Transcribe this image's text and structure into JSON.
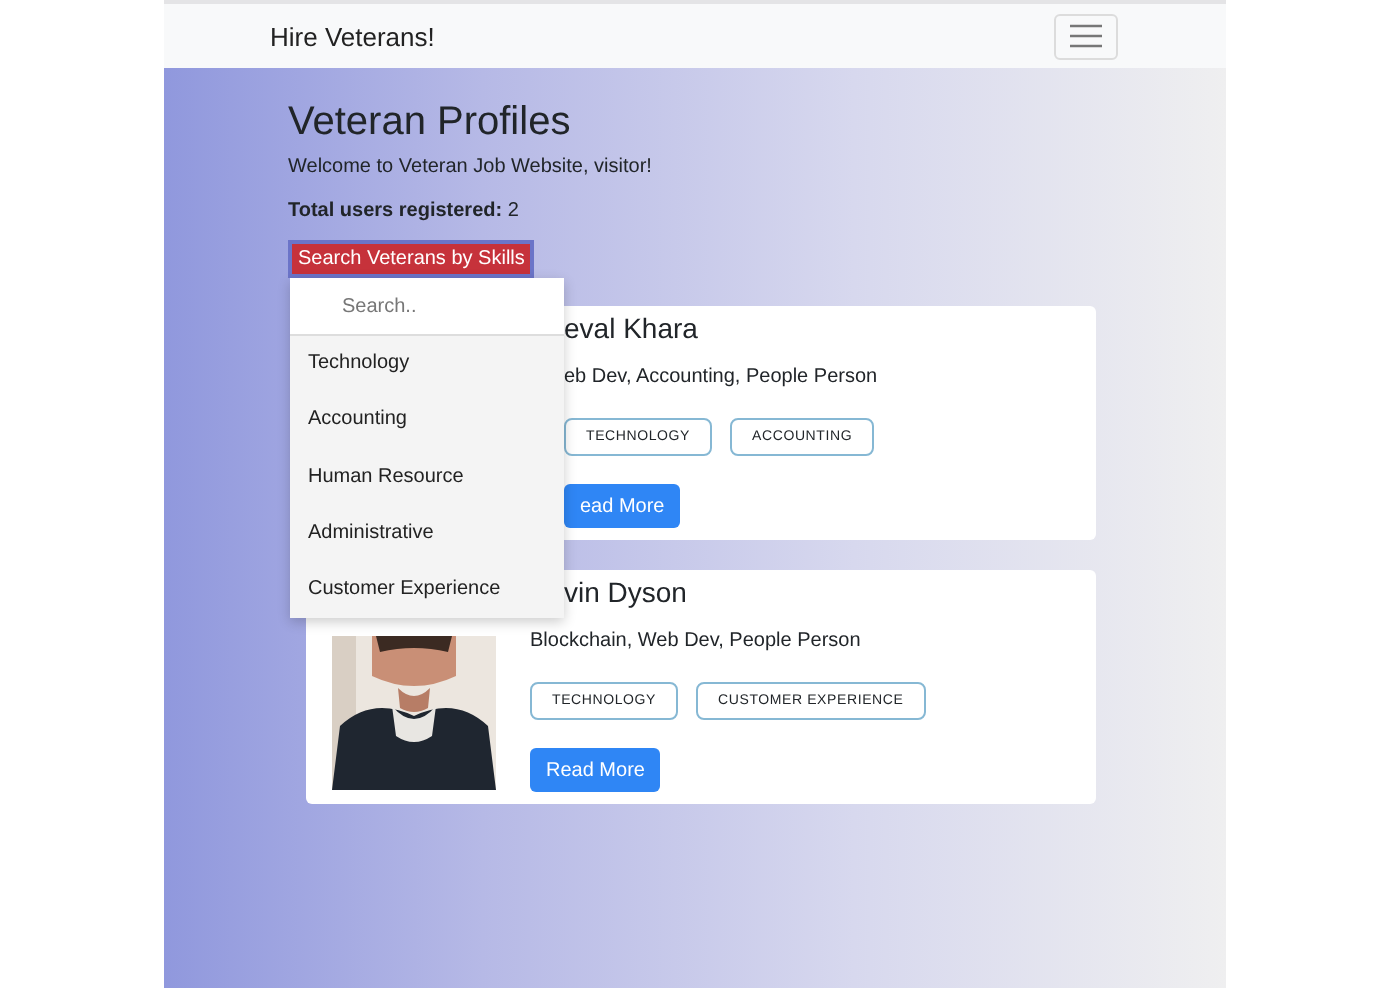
{
  "navbar": {
    "brand": "Hire Veterans!"
  },
  "heading": "Veteran Profiles",
  "welcome": "Welcome to Veteran Job Website, visitor!",
  "total": "**Total users registered:** 2",
  "search_button": "Search Veterans by Skills",
  "dropdown": {
    "placeholder": "Search..",
    "items": [
      "Technology",
      "Accounting",
      "Human Resource",
      "Administrative",
      "Customer Experience"
    ]
  },
  "cards": [
    {
      "name": "eval Khara",
      "skills": "eb Dev, Accounting, People Person",
      "tags": [
        "TECHNOLOGY",
        "ACCOUNTING"
      ],
      "button": "ead More"
    },
    {
      "name": "vin Dyson",
      "skills": "Blockchain, Web Dev, People Person",
      "tags": [
        "TECHNOLOGY",
        "CUSTOMER EXPERIENCE"
      ],
      "button": "Read More"
    }
  ]
}
